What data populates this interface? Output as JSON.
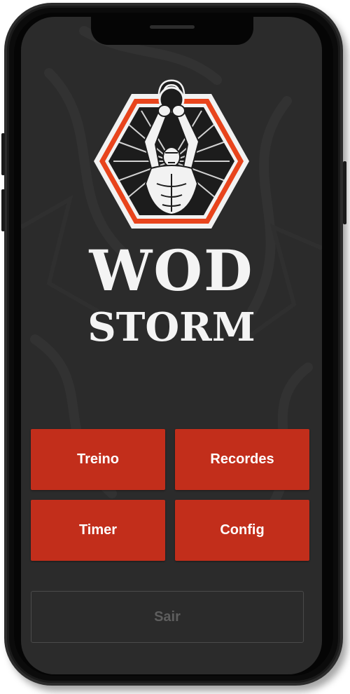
{
  "app": {
    "brand_line1": "WOD",
    "brand_line2": "STORM",
    "logo_icon": "weightlifter-kettlebell-emblem"
  },
  "menu": {
    "treino_label": "Treino",
    "recordes_label": "Recordes",
    "timer_label": "Timer",
    "config_label": "Config"
  },
  "footer": {
    "exit_label": "Sair"
  },
  "colors": {
    "screen_background": "#2b2b2b",
    "button_red": "#c22e1b",
    "emblem_orange": "#e8441c",
    "exit_text": "#5e5e5e"
  }
}
